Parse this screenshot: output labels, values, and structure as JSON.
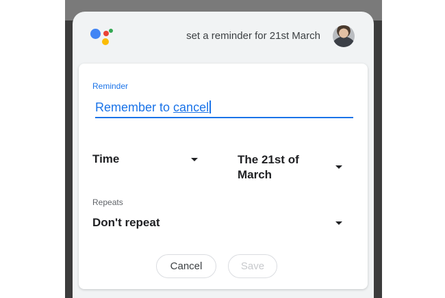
{
  "header": {
    "query": "set a reminder for 21st March",
    "logo_icon": "google-assistant-icon",
    "avatar_icon": "user-avatar"
  },
  "reminder": {
    "label": "Reminder",
    "value_prefix": "Remember to ",
    "value_word": "cancel"
  },
  "time": {
    "value": "Time",
    "icon": "dropdown-arrow-icon"
  },
  "date": {
    "line1": "The 21st of",
    "line2": "March",
    "icon": "dropdown-arrow-icon"
  },
  "repeats": {
    "label": "Repeats",
    "value": "Don't repeat",
    "icon": "dropdown-arrow-icon"
  },
  "actions": {
    "cancel": "Cancel",
    "save": "Save"
  },
  "colors": {
    "accent": "#1a73e8",
    "text": "#202124",
    "disabled": "#c7c9cc"
  }
}
